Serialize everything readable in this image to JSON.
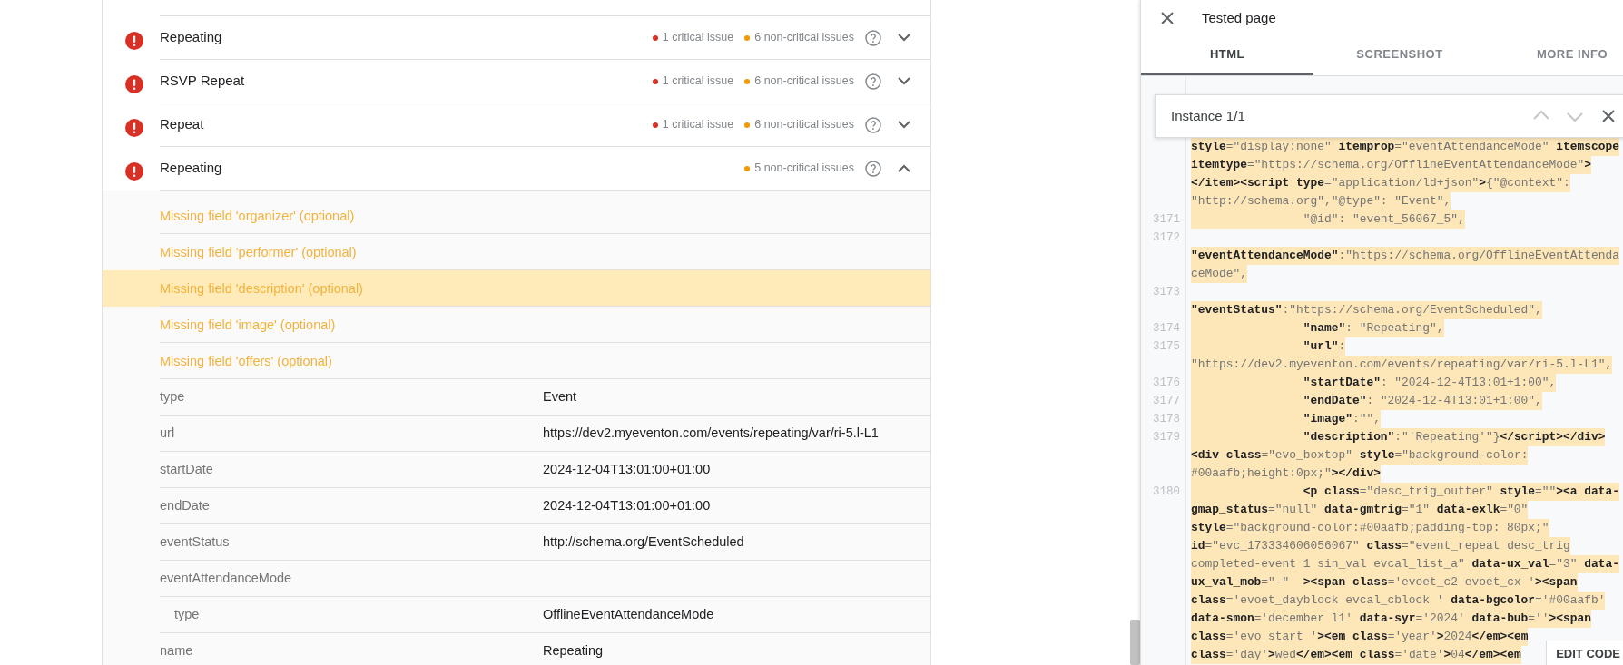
{
  "results": [
    {
      "name": "Repeating",
      "expanded": false,
      "issues": [
        {
          "text": "1 critical issue",
          "color": "#d93025"
        },
        {
          "text": "6 non-critical issues",
          "color": "#f29900"
        }
      ]
    },
    {
      "name": "RSVP Repeat",
      "expanded": false,
      "issues": [
        {
          "text": "1 critical issue",
          "color": "#d93025"
        },
        {
          "text": "6 non-critical issues",
          "color": "#f29900"
        }
      ]
    },
    {
      "name": "Repeat",
      "expanded": false,
      "issues": [
        {
          "text": "1 critical issue",
          "color": "#d93025"
        },
        {
          "text": "6 non-critical issues",
          "color": "#f29900"
        }
      ]
    },
    {
      "name": "Repeating",
      "expanded": true,
      "issues": [
        {
          "text": "5 non-critical issues",
          "color": "#f29900"
        }
      ]
    }
  ],
  "missing_fields": [
    {
      "text": "Missing field 'organizer' (optional)",
      "selected": false
    },
    {
      "text": "Missing field 'performer' (optional)",
      "selected": false
    },
    {
      "text": "Missing field 'description' (optional)",
      "selected": true
    },
    {
      "text": "Missing field 'image' (optional)",
      "selected": false
    },
    {
      "text": "Missing field 'offers' (optional)",
      "selected": false
    }
  ],
  "properties": [
    {
      "label": "type",
      "value": "Event"
    },
    {
      "label": "url",
      "value": "https://dev2.myeventon.com/events/repeating/var/ri-5.l-L1"
    },
    {
      "label": "startDate",
      "value": "2024-12-04T13:01:00+01:00"
    },
    {
      "label": "endDate",
      "value": "2024-12-04T13:01:00+01:00"
    },
    {
      "label": "eventStatus",
      "value": "http://schema.org/EventScheduled"
    },
    {
      "label": "eventAttendanceMode",
      "children": [
        {
          "label": "type",
          "value": "OfflineEventAttendanceMode"
        }
      ]
    },
    {
      "label": "name",
      "value": "Repeating"
    }
  ],
  "panel": {
    "title": "Tested page",
    "tabs": [
      {
        "label": "HTML",
        "selected": true
      },
      {
        "label": "SCREENSHOT",
        "selected": false
      },
      {
        "label": "MORE INFO",
        "selected": false
      }
    ],
    "find_bar": {
      "label": "Instance 1/1",
      "nav": [
        {
          "disabled": true
        },
        {
          "disabled": true
        }
      ]
    },
    "code_lines": [
      {
        "text": "**style**=\"display:none\" **itemprop**=\"eventAttendanceMode\" **itemscope**",
        "highlighted": true
      },
      {
        "text": "**itemtype**=\"https://schema.org/OfflineEventAttendanceMode\"**>**",
        "highlighted": true
      },
      {
        "text": "**</item><script** **type**=\"application/ld+json\"**>**{\"@context\":",
        "highlighted": true
      },
      {
        "text": "\"http://schema.org\",\"@type\": \"Event\",",
        "highlighted": true
      },
      {
        "number": "3171",
        "text": "                \"@id\": \"event_56067_5\",",
        "highlighted": true
      },
      {
        "number": "3172"
      },
      {
        "text": "**\"eventAttendanceMode\"**:\"https://schema.org/OfflineEventAttenda",
        "highlighted": true
      },
      {
        "text": "ceMode\",",
        "highlighted": true
      },
      {
        "number": "3173"
      },
      {
        "text": "**\"eventStatus\"**:\"https://schema.org/EventScheduled\",",
        "highlighted": true
      },
      {
        "number": "3174",
        "text": "                **\"name\"**: \"Repeating\",",
        "highlighted": true
      },
      {
        "number": "3175",
        "text": "                **\"url\"**:",
        "highlighted": true
      },
      {
        "text": "\"https://dev2.myeventon.com/events/repeating/var/ri-5.l-L1\",",
        "highlighted": true
      },
      {
        "number": "3176",
        "text": "                **\"startDate\"**: \"2024-12-4T13:01+1:00\",",
        "highlighted": true
      },
      {
        "number": "3177",
        "text": "                **\"endDate\"**: \"2024-12-4T13:01+1:00\",",
        "highlighted": true
      },
      {
        "number": "3178",
        "text": "                **\"image\"**:\"\",",
        "highlighted": true
      },
      {
        "number": "3179",
        "text": "                **\"description\"**:\"'Repeating'\"}**</script></div>**",
        "highlighted": true
      },
      {
        "text": "**<div** **class**=\"evo_boxtop\" **style**=\"background-color:",
        "highlighted": true
      },
      {
        "text": "#00aafb;height:0px;\"**></div>**",
        "highlighted": true
      },
      {
        "number": "3180",
        "text": "                **<p** **class**=\"desc_trig_outter\" **style**=\"\"**><a** **data-**",
        "highlighted": true
      },
      {
        "text": "**gmap_status**=\"null\" **data-gmtrig**=\"1\" **data-exlk**=\"0\"",
        "highlighted": true
      },
      {
        "text": "**style**=\"background-color:#00aafb;padding-top: 80px;\"",
        "highlighted": true
      },
      {
        "text": "**id**=\"evc_173334606056067\" **class**=\"event_repeat desc_trig",
        "highlighted": true
      },
      {
        "text": "completed-event 1 sin_val evcal_list_a\" **data-ux_val**=\"3\" **data-**",
        "highlighted": true
      },
      {
        "text": "**ux_val_mob**=\"-\"  **><span** **class**='evoet_c2 evoet_cx '**><span**",
        "highlighted": true
      },
      {
        "text": "**class**='evoet_dayblock evcal_cblock ' **data-bgcolor**='#00aafb'",
        "highlighted": true
      },
      {
        "text": "**data-smon**='december l1' **data-syr**='2024' **data-bub**=''**><span**",
        "highlighted": true
      },
      {
        "text": "**class**='evo_start '**><em** **class**='year'**>**2024**</em><em**",
        "highlighted": true
      },
      {
        "text": "**class**='day'**>**wed**</em><em** **class**='date'**>**04**</em><em**",
        "highlighted": true
      }
    ],
    "edit_button": "EDIT CODE"
  }
}
